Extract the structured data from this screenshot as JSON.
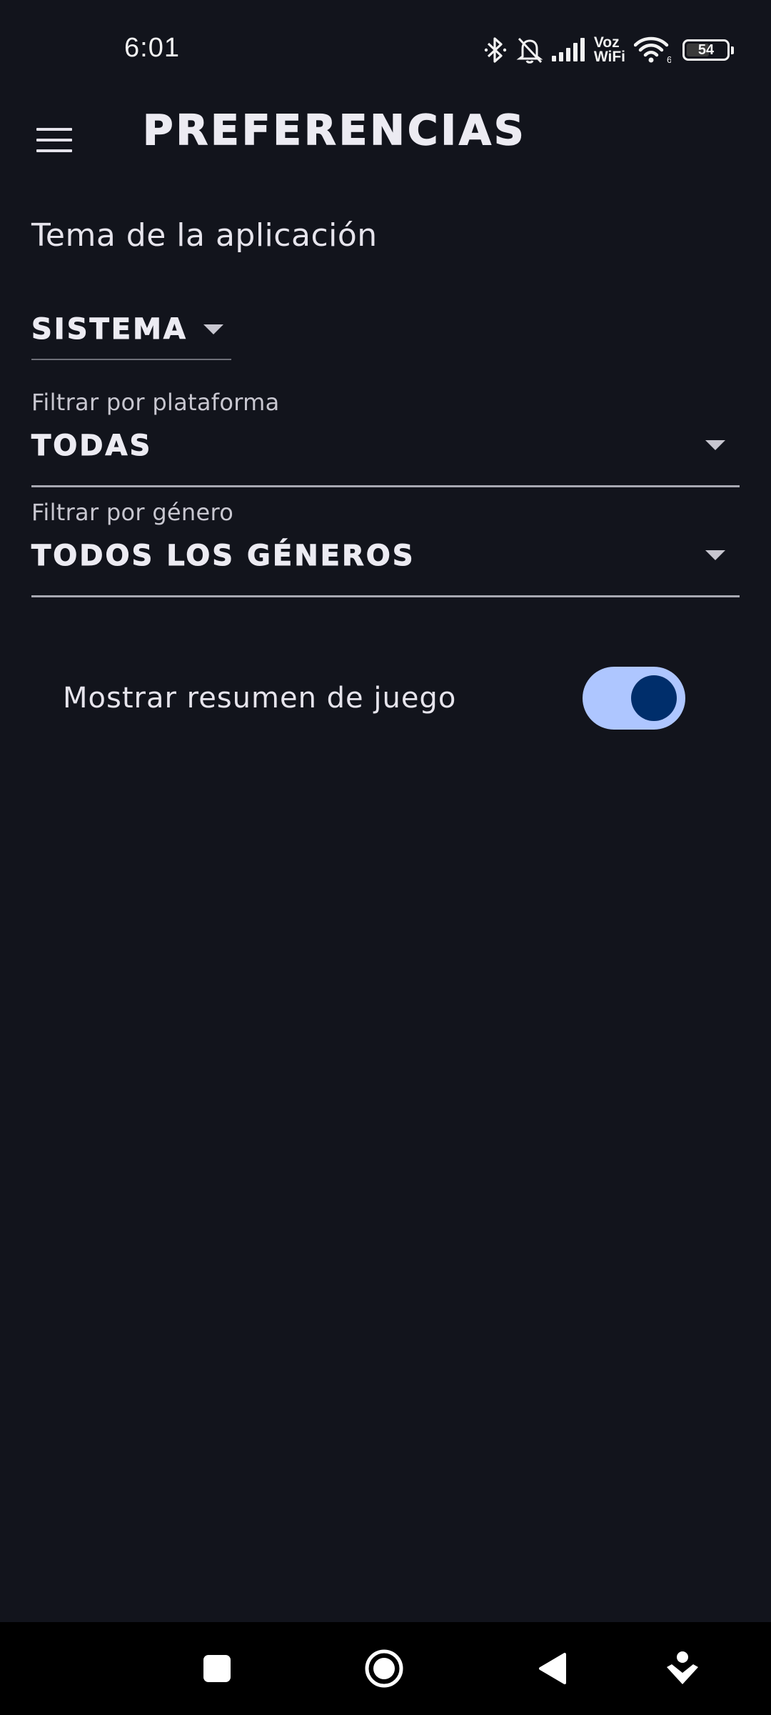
{
  "status_bar": {
    "time": "6:01",
    "voz_line1": "Voz",
    "voz_line2": "WiFi",
    "wifi_sub": "6",
    "battery": "54",
    "icons": [
      "bluetooth-icon",
      "bell-off-icon",
      "signal-icon",
      "voz-wifi-icon",
      "wifi-icon",
      "battery-icon"
    ]
  },
  "app_bar": {
    "title": "PREFERENCIAS",
    "menu_icon": "menu-icon"
  },
  "theme": {
    "label": "Tema de la aplicación",
    "value": "SISTEMA"
  },
  "platform_filter": {
    "label": "Filtrar por plataforma",
    "value": "TODAS"
  },
  "genre_filter": {
    "label": "Filtrar por género",
    "value": "TODOS LOS GÉNEROS"
  },
  "summary_toggle": {
    "label": "Mostrar resumen de juego",
    "on": true
  },
  "colors": {
    "background": "#12141c",
    "switch_track": "#aec6ff",
    "switch_thumb": "#002e6b"
  },
  "nav_bar": {
    "buttons": [
      "recents-square-icon",
      "home-circle-icon",
      "back-triangle-icon",
      "assistant-icon"
    ]
  }
}
